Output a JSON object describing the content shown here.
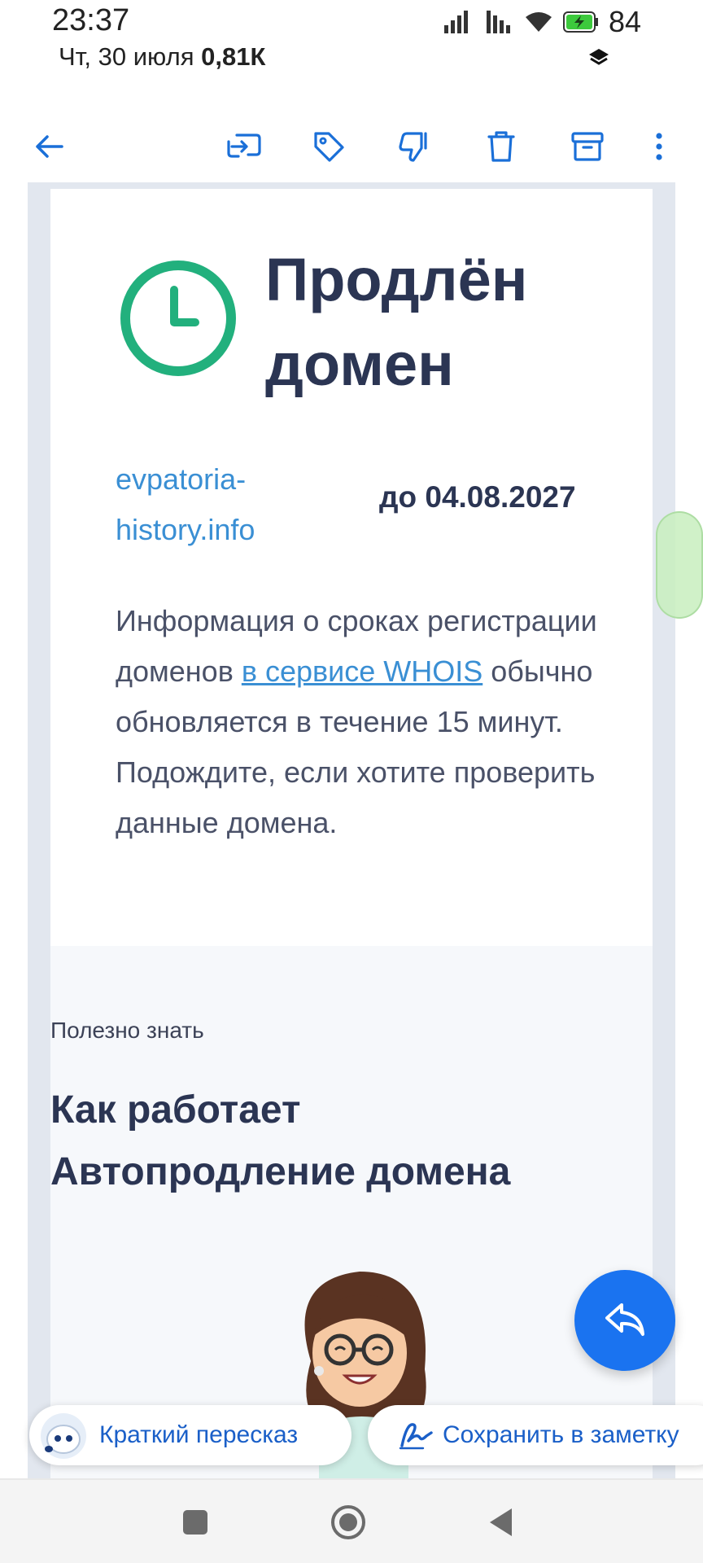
{
  "status_bar": {
    "time": "23:37",
    "date_prefix": "Чт, 30 июля",
    "data_speed": "0,81К",
    "battery_percent": "84"
  },
  "toolbar": {
    "icons": [
      "back-arrow-icon",
      "move-to-folder-icon",
      "label-icon",
      "spam-icon",
      "delete-icon",
      "archive-icon",
      "more-icon"
    ],
    "accent_color": "#1a6fd8"
  },
  "email": {
    "title": "Продлён домен",
    "domain": "evpatoria-history.info",
    "expiry": "до 04.08.2027",
    "info_before_link": "Информация о сроках регистрации доменов ",
    "info_link": "в сервисе WHOIS",
    "info_after_link": " обычно обновляется в течение 15 минут. Подождите, если хотите проверить данные домена.",
    "useful_label": "Полезно знать",
    "howto_title": "Как работает Автопродление домена",
    "clock_color": "#22b07d",
    "link_color": "#3a8fd4"
  },
  "actions": {
    "summary_chip": "Краткий пересказ",
    "note_chip": "Сохранить в заметку"
  },
  "fab": {
    "icon": "reply-icon",
    "color": "#1a73f0"
  }
}
